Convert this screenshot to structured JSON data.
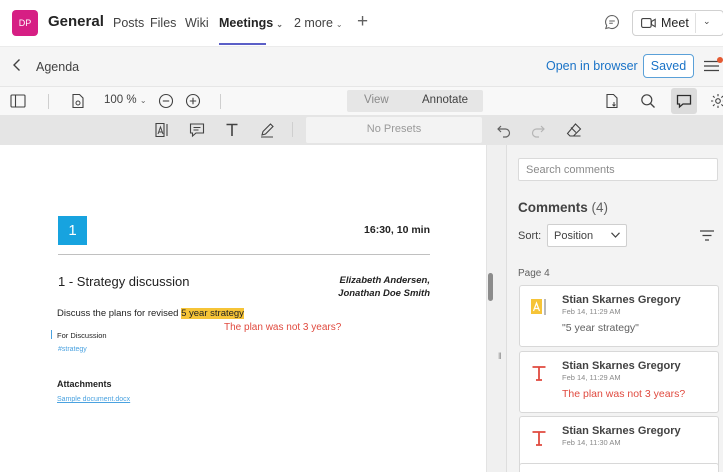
{
  "header": {
    "team_initials": "DP",
    "team_name": "General",
    "tabs": [
      {
        "label": "Posts"
      },
      {
        "label": "Files"
      },
      {
        "label": "Wiki"
      },
      {
        "label": "Meetings"
      },
      {
        "label": "2 more"
      }
    ],
    "active_tab": "Meetings",
    "meet_label": "Meet"
  },
  "docbar": {
    "title": "Agenda",
    "open_in_browser": "Open in browser",
    "saved": "Saved"
  },
  "viewer_toolbar": {
    "zoom": "100 %",
    "mode_view": "View",
    "mode_annotate": "Annotate",
    "active_mode": "Annotate"
  },
  "annotate_toolbar": {
    "presets": "No Presets"
  },
  "document": {
    "item_number": "1",
    "time": "16:30, 10 min",
    "item_title": "1 - Strategy discussion",
    "presenters": [
      "Elizabeth Andersen,",
      "Jonathan Doe Smith"
    ],
    "description_prefix": "Discuss the plans for revised ",
    "description_highlight": "5 year strategy",
    "purpose": "For Discussion",
    "tag": "#strategy",
    "attachments_heading": "Attachments",
    "attachment_link": "Sample document.docx",
    "free_text_annotation": "The plan was not 3 years?"
  },
  "comments": {
    "search_placeholder": "Search comments",
    "title": "Comments",
    "count": "(4)",
    "sort_label": "Sort:",
    "sort_value": "Position",
    "page_label": "Page 4",
    "items": [
      {
        "author": "Stian Skarnes Gregory",
        "time": "Feb 14, 11:29 AM",
        "text": "\"5 year strategy\"",
        "icon": "highlight-icon",
        "style": "quote"
      },
      {
        "author": "Stian Skarnes Gregory",
        "time": "Feb 14, 11:29 AM",
        "text": "The plan was not 3 years?",
        "icon": "text-annotation-icon",
        "style": "red"
      },
      {
        "author": "Stian Skarnes Gregory",
        "time": "Feb 14, 11:30 AM",
        "text": "",
        "icon": "text-annotation-icon",
        "style": "red"
      }
    ]
  },
  "colors": {
    "accent": "#5b5fc7",
    "team_avatar": "#d61f84",
    "link_blue": "#1a73c7",
    "annotation_red": "#e04a3f",
    "highlight_yellow": "#f6c437",
    "item_badge": "#17a3df"
  }
}
